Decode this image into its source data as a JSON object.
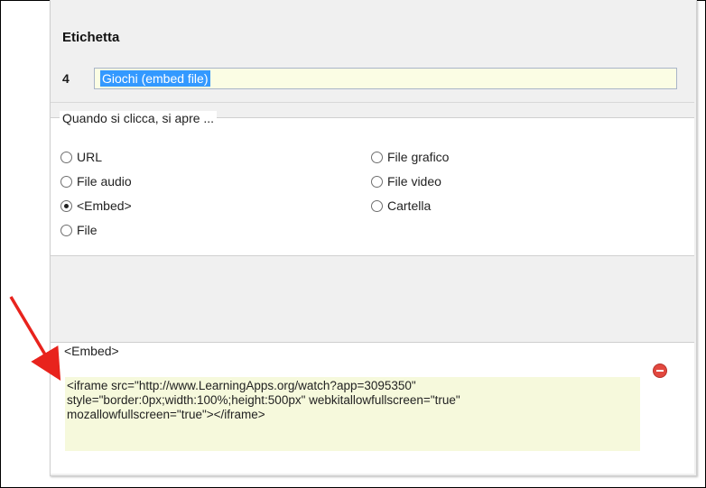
{
  "label_section": {
    "title": "Etichetta",
    "number": "4",
    "value": "Giochi (embed file)"
  },
  "open_options": {
    "legend": "Quando si clicca, si apre ...",
    "options": [
      {
        "label": "URL",
        "selected": false
      },
      {
        "label": "File audio",
        "selected": false
      },
      {
        "label": "<Embed>",
        "selected": true
      },
      {
        "label": "File",
        "selected": false
      },
      {
        "label": "File grafico",
        "selected": false
      },
      {
        "label": "File video",
        "selected": false
      },
      {
        "label": "Cartella",
        "selected": false
      }
    ]
  },
  "embed_section": {
    "title": "<Embed>",
    "code": "<iframe src=\"http://www.LearningApps.org/watch?app=3095350\"\nstyle=\"border:0px;width:100%;height:500px\" webkitallowfullscreen=\"true\"\nmozallowfullscreen=\"true\"></iframe>",
    "remove_icon": "remove-circle-icon"
  },
  "colors": {
    "annotation_arrow": "#e8231d",
    "input_background": "#fbfde4",
    "selection": "#3399ff"
  }
}
